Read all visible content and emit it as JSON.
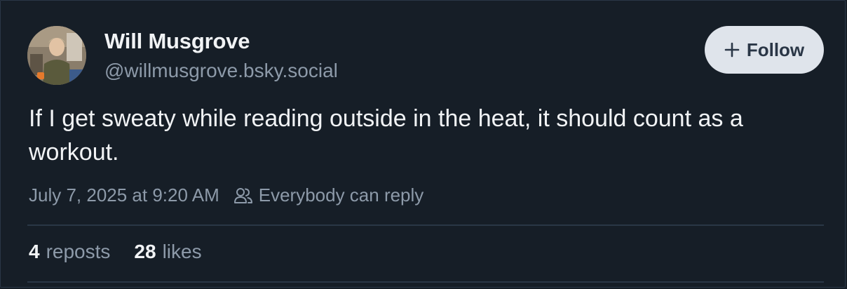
{
  "post": {
    "author": {
      "display_name": "Will Musgrove",
      "handle": "@willmusgrove.bsky.social",
      "avatar_icon": "user-avatar-photo"
    },
    "follow_button": {
      "label": "Follow",
      "icon": "plus-icon"
    },
    "text": "If I get sweaty while reading outside in the heat, it should count as a workout.",
    "timestamp": "July 7, 2025 at 9:20 AM",
    "reply_setting": {
      "label": "Everybody can reply",
      "icon": "people-icon"
    },
    "stats": {
      "reposts_count": "4",
      "reposts_label": "reposts",
      "likes_count": "28",
      "likes_label": "likes"
    }
  },
  "colors": {
    "background": "#161e27",
    "text_primary": "#f1f3f5",
    "text_secondary": "#8d9aa9",
    "button_bg": "#dfe4eb",
    "button_text": "#2a3646",
    "divider": "#2a3746"
  }
}
